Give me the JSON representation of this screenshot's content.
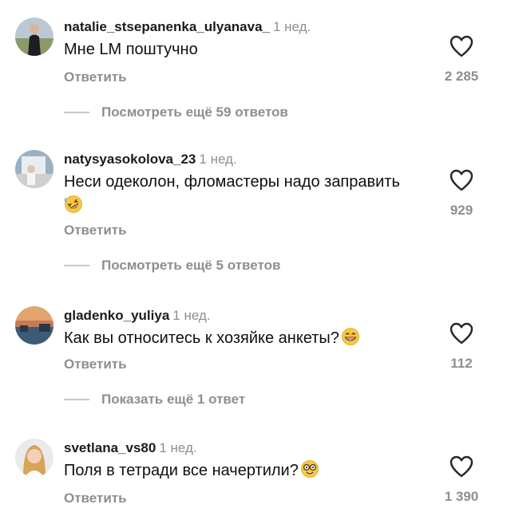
{
  "comments": [
    {
      "username": "natalie_stsepanenka_ulyanava_",
      "time": "1 нед.",
      "text": "Мне LM поштучно",
      "reply_label": "Ответить",
      "likes": "2 285",
      "icon": "heart-outline-icon"
    },
    {
      "username": "natysyasokolova_23",
      "time": "1 нед.",
      "text": "Неси одеколон,  фломастеры надо заправить",
      "emoji": "rolling-on-floor-laughing-emoji",
      "reply_label": "Ответить",
      "likes": "929",
      "icon": "heart-outline-icon"
    },
    {
      "username": "gladenko_yuliya",
      "time": "1 нед.",
      "text": "Как вы относитесь к хозяйке анкеты?",
      "emoji": "grinning-face-emoji",
      "reply_label": "Ответить",
      "likes": "112",
      "icon": "heart-outline-icon"
    },
    {
      "username": "svetlana_vs80",
      "time": "1 нед.",
      "text": "Поля в тетради все начертили?",
      "emoji": "nerd-face-emoji",
      "reply_label": "Ответить",
      "likes": "1 390",
      "icon": "heart-outline-icon"
    }
  ],
  "view_more": [
    "Посмотреть ещё 59 ответов",
    "Посмотреть ещё 5 ответов",
    "Показать ещё 1 ответ"
  ],
  "colors": {
    "text": "#0f0f0f",
    "secondary": "#8e8e8e",
    "divider": "#c7c7c7",
    "background": "#ffffff"
  }
}
